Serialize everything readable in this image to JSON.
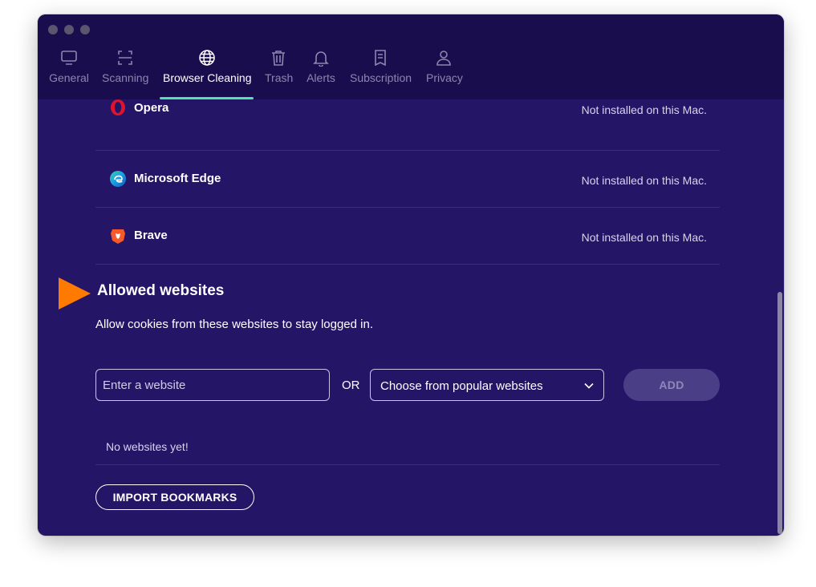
{
  "tabs": [
    {
      "label": "General",
      "icon": "monitor-icon"
    },
    {
      "label": "Scanning",
      "icon": "scan-icon"
    },
    {
      "label": "Browser Cleaning",
      "icon": "globe-icon",
      "active": true
    },
    {
      "label": "Trash",
      "icon": "trash-icon"
    },
    {
      "label": "Alerts",
      "icon": "bell-icon"
    },
    {
      "label": "Subscription",
      "icon": "receipt-icon"
    },
    {
      "label": "Privacy",
      "icon": "person-icon"
    }
  ],
  "browsers": [
    {
      "name": "Opera",
      "status": "Not installed on this Mac.",
      "icon": "opera-icon"
    },
    {
      "name": "Microsoft Edge",
      "status": "Not installed on this Mac.",
      "icon": "edge-icon"
    },
    {
      "name": "Brave",
      "status": "Not installed on this Mac.",
      "icon": "brave-icon"
    }
  ],
  "allowed": {
    "title": "Allowed websites",
    "description": "Allow cookies from these websites to stay logged in.",
    "input_placeholder": "Enter a website",
    "or_label": "OR",
    "select_value": "Choose from popular websites",
    "add_label": "ADD",
    "empty_text": "No websites yet!",
    "import_label": "IMPORT BOOKMARKS"
  },
  "colors": {
    "background": "#241566",
    "header": "#190d4e",
    "active_tab_indicator": "#4fe3b0",
    "arrow": "#ff7a00"
  }
}
